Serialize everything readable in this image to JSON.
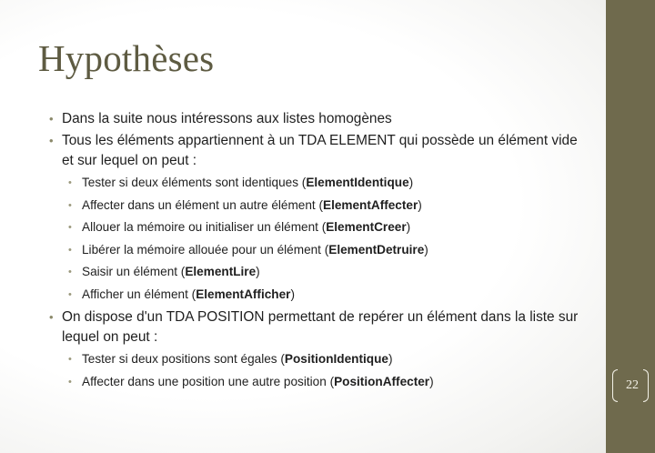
{
  "slide": {
    "title": "Hypothèses",
    "page_number": "22",
    "colors": {
      "sidebar": "#6f6a4d",
      "title": "#5e5b42",
      "bullet": "#8c8a6b"
    },
    "bullets": [
      {
        "text": "Dans la suite nous intéressons aux listes homogènes"
      },
      {
        "text": "Tous les éléments appartiennent à un TDA ELEMENT qui possède un élément vide et sur lequel on peut :",
        "sub": [
          {
            "before": "Tester si deux éléments sont identiques (",
            "bold": "ElementIdentique",
            "after": ")"
          },
          {
            "before": "Affecter dans un élément un autre élément (",
            "bold": "ElementAffecter",
            "after": ")"
          },
          {
            "before": "Allouer la mémoire ou initialiser un élément (",
            "bold": "ElementCreer",
            "after": ")"
          },
          {
            "before": "Libérer la mémoire allouée pour un élément (",
            "bold": "ElementDetruire",
            "after": ")"
          },
          {
            "before": "Saisir un élément (",
            "bold": "ElementLire",
            "after": ")"
          },
          {
            "before": "Afficher un élément (",
            "bold": "ElementAfficher",
            "after": ")"
          }
        ]
      },
      {
        "text": "On dispose d'un TDA POSITION permettant de repérer un élément dans la liste sur lequel on peut :",
        "sub": [
          {
            "before": "Tester si deux positions sont égales (",
            "bold": "PositionIdentique",
            "after": ")"
          },
          {
            "before": "Affecter dans une position une autre position (",
            "bold": "PositionAffecter",
            "after": ")"
          }
        ]
      }
    ]
  }
}
